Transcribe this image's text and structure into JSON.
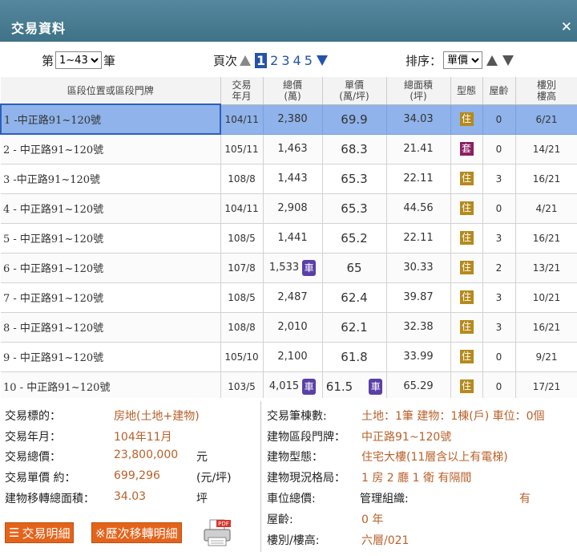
{
  "window": {
    "title": "交易資料",
    "close": "✕"
  },
  "controls": {
    "count_prefix": "第",
    "count_select": "1~43",
    "count_suffix": "筆",
    "page_label": "頁次",
    "pages": [
      "1",
      "2",
      "3",
      "4",
      "5"
    ],
    "current_page": "1",
    "sort_label": "排序：",
    "sort_select": "單價"
  },
  "table": {
    "headers": [
      "區段位置或區段門牌",
      "交易\n年月",
      "總價\n(萬)",
      "單價\n(萬/坪)",
      "總面積\n(坪)",
      "型態",
      "屋齡",
      "樓別\n樓高"
    ],
    "rows": [
      {
        "addr": "1  -中正路91~120號",
        "date": "104/11",
        "total": "2,380",
        "total_car": false,
        "unit": "69.9",
        "unit_car": false,
        "area": "34.03",
        "type": "住",
        "age": "0",
        "floor": "6/21"
      },
      {
        "addr": "2  - 中正路91~120號",
        "date": "105/11",
        "total": "1,463",
        "total_car": false,
        "unit": "68.3",
        "unit_car": false,
        "area": "21.41",
        "type": "套",
        "age": "0",
        "floor": "14/21"
      },
      {
        "addr": "3  -中正路91~120號",
        "date": "108/8",
        "total": "1,443",
        "total_car": false,
        "unit": "65.3",
        "unit_car": false,
        "area": "22.11",
        "type": "住",
        "age": "3",
        "floor": "16/21"
      },
      {
        "addr": "4  - 中正路91~120號",
        "date": "104/11",
        "total": "2,908",
        "total_car": false,
        "unit": "65.3",
        "unit_car": false,
        "area": "44.56",
        "type": "住",
        "age": "0",
        "floor": "4/21"
      },
      {
        "addr": "5  - 中正路91~120號",
        "date": "108/5",
        "total": "1,441",
        "total_car": false,
        "unit": "65.2",
        "unit_car": false,
        "area": "22.11",
        "type": "住",
        "age": "3",
        "floor": "16/21"
      },
      {
        "addr": "6  - 中正路91~120號",
        "date": "107/8",
        "total": "1,533",
        "total_car": true,
        "unit": "65",
        "unit_car": false,
        "area": "30.33",
        "type": "住",
        "age": "2",
        "floor": "13/21"
      },
      {
        "addr": "7  - 中正路91~120號",
        "date": "108/5",
        "total": "2,487",
        "total_car": false,
        "unit": "62.4",
        "unit_car": false,
        "area": "39.87",
        "type": "住",
        "age": "3",
        "floor": "10/21"
      },
      {
        "addr": "8  - 中正路91~120號",
        "date": "108/8",
        "total": "2,010",
        "total_car": false,
        "unit": "62.1",
        "unit_car": false,
        "area": "32.38",
        "type": "住",
        "age": "3",
        "floor": "16/21"
      },
      {
        "addr": "9  - 中正路91~120號",
        "date": "105/10",
        "total": "2,100",
        "total_car": false,
        "unit": "61.8",
        "unit_car": false,
        "area": "33.99",
        "type": "住",
        "age": "0",
        "floor": "9/21"
      },
      {
        "addr": "10  - 中正路91~120號",
        "date": "103/5",
        "total": "4,015",
        "total_car": true,
        "unit": "61.5",
        "unit_car": true,
        "area": "65.29",
        "type": "住",
        "age": "0",
        "floor": "17/21"
      }
    ],
    "car_badge": "車"
  },
  "detail": {
    "left": [
      {
        "label": "交易標的：",
        "value": "房地(土地+建物)",
        "unit": ""
      },
      {
        "label": "交易年月：",
        "value": "104年11月",
        "unit": ""
      },
      {
        "label": "交易總價：",
        "value": "23,800,000",
        "unit": "元"
      },
      {
        "label": "交易單價 約：",
        "value": "699,296",
        "unit": "(元/坪)"
      },
      {
        "label": "建物移轉總面積：",
        "value": "34.03",
        "unit": "坪"
      }
    ],
    "right": [
      {
        "label": "交易筆棟數:",
        "value": "土地：1筆 建物：1棟(戶) 車位：0個"
      },
      {
        "label": "建物區段門牌：",
        "value": "中正路91~120號"
      },
      {
        "label": "建物型態：",
        "value": "住宅大樓(11層含以上有電梯)"
      },
      {
        "label": "建物現況格局：",
        "value": "1 房 2 廳 1 衛 有隔間"
      },
      {
        "label": "車位總價:",
        "label2": "管理組織:",
        "value": "有"
      },
      {
        "label": "屋齡:",
        "value": "0  年"
      },
      {
        "label": "樓別/樓高:",
        "value": "六層/021"
      }
    ],
    "buttons": {
      "detail": "交易明細",
      "history": "※歷次移轉明細"
    },
    "pdf_label": "PDF"
  }
}
